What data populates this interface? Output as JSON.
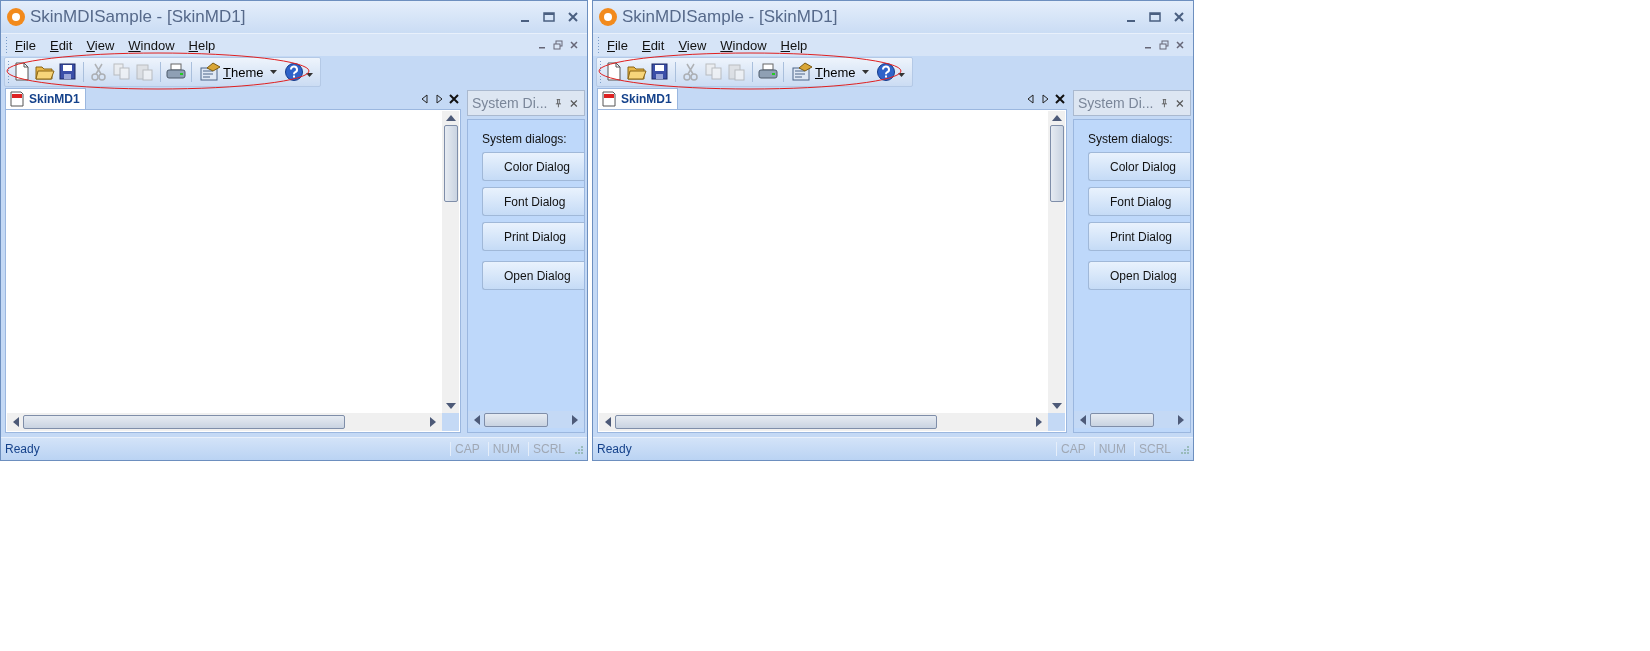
{
  "windows": [
    {
      "title": "SkinMDISample - [SkinMD1]",
      "menu": [
        {
          "label": "File"
        },
        {
          "label": "Edit"
        },
        {
          "label": "View"
        },
        {
          "label": "Window"
        },
        {
          "label": "Help"
        }
      ],
      "toolbar": [
        {
          "kind": "icon",
          "disabled": false
        },
        {
          "kind": "icon",
          "disabled": false
        },
        {
          "kind": "icon",
          "disabled": false
        },
        {
          "kind": "separator"
        },
        {
          "kind": "icon",
          "disabled": true
        },
        {
          "kind": "icon",
          "disabled": true
        },
        {
          "kind": "icon",
          "disabled": true
        },
        {
          "kind": "separator"
        },
        {
          "kind": "icon",
          "disabled": false
        },
        {
          "kind": "separator"
        },
        {
          "kind": "dropdown",
          "label": "Theme"
        },
        {
          "kind": "icon-dropdown"
        }
      ],
      "document_tab": {
        "label": "SkinMD1",
        "selected": true
      },
      "panel": {
        "title": "System Di...",
        "heading": "System dialogs:",
        "buttons": [
          "Color Dialog",
          "Font Dialog",
          "Print Dialog",
          "Open Dialog"
        ]
      },
      "status_bar": {
        "text": "Ready",
        "indicators": [
          {
            "label": "CAP",
            "on": false
          },
          {
            "label": "NUM",
            "on": false
          },
          {
            "label": "SCRL",
            "on": false
          }
        ]
      }
    },
    {
      "title": "SkinMDISample - [SkinMD1]",
      "menu": [
        {
          "label": "File"
        },
        {
          "label": "Edit"
        },
        {
          "label": "View"
        },
        {
          "label": "Window"
        },
        {
          "label": "Help"
        }
      ],
      "toolbar": [
        {
          "kind": "icon",
          "disabled": false
        },
        {
          "kind": "icon",
          "disabled": false
        },
        {
          "kind": "icon",
          "disabled": false
        },
        {
          "kind": "separator"
        },
        {
          "kind": "icon",
          "disabled": true
        },
        {
          "kind": "icon",
          "disabled": true
        },
        {
          "kind": "icon",
          "disabled": true
        },
        {
          "kind": "separator"
        },
        {
          "kind": "icon",
          "disabled": false
        },
        {
          "kind": "separator"
        },
        {
          "kind": "dropdown",
          "label": "Theme"
        },
        {
          "kind": "icon-dropdown"
        }
      ],
      "document_tab": {
        "label": "SkinMD1",
        "selected": true
      },
      "panel": {
        "title": "System Di...",
        "heading": "System dialogs:",
        "buttons": [
          "Color Dialog",
          "Font Dialog",
          "Print Dialog",
          "Open Dialog"
        ]
      },
      "status_bar": {
        "text": "Ready",
        "indicators": [
          {
            "label": "CAP",
            "on": false
          },
          {
            "label": "NUM",
            "on": false
          },
          {
            "label": "SCRL",
            "on": false
          }
        ]
      }
    }
  ]
}
